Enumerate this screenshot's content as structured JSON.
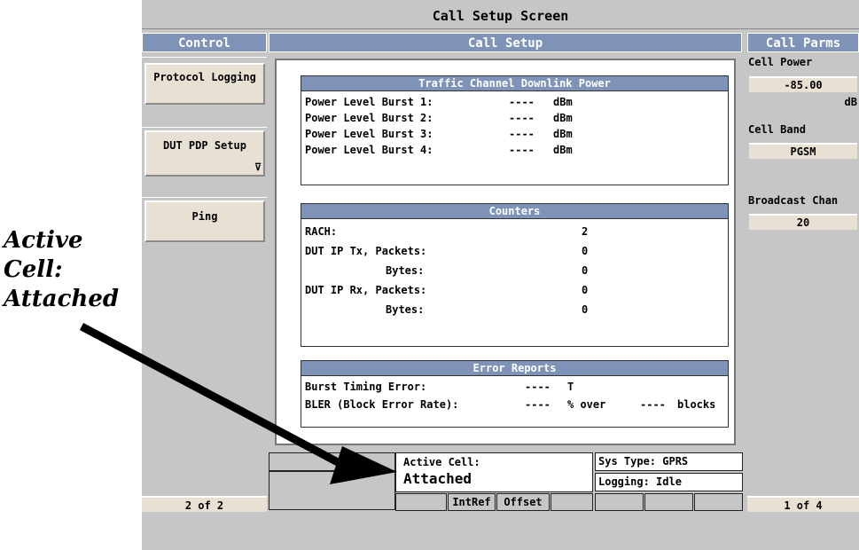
{
  "screen_title": "Call Setup Screen",
  "control": {
    "header": "Control",
    "keys": [
      {
        "label": "Protocol Logging"
      },
      {
        "label": "DUT PDP Setup",
        "arrow": "⊽"
      },
      {
        "label": "Ping"
      }
    ],
    "page": "2 of 2"
  },
  "call_setup": {
    "header": "Call Setup",
    "traffic": {
      "title": "Traffic Channel Downlink Power",
      "rows": [
        {
          "label": "Power Level Burst 1:",
          "value": "----",
          "unit": "dBm"
        },
        {
          "label": "Power Level Burst 2:",
          "value": "----",
          "unit": "dBm"
        },
        {
          "label": "Power Level Burst 3:",
          "value": "----",
          "unit": "dBm"
        },
        {
          "label": "Power Level Burst 4:",
          "value": "----",
          "unit": "dBm"
        }
      ]
    },
    "counters": {
      "title": "Counters",
      "rach_label": "RACH:",
      "rach_value": "2",
      "tx_label": "DUT IP Tx, Packets:",
      "tx_packets": "0",
      "tx_bytes_label": "Bytes:",
      "tx_bytes": "0",
      "rx_label": "DUT IP Rx, Packets:",
      "rx_packets": "0",
      "rx_bytes_label": "Bytes:",
      "rx_bytes": "0"
    },
    "errors": {
      "title": "Error Reports",
      "burst_label": "Burst Timing Error:",
      "burst_value": "----",
      "burst_unit": "T",
      "bler_label": "BLER (Block Error Rate):",
      "bler_value": "----",
      "bler_unit": "% over",
      "bler_blocks": "----",
      "bler_blocks_unit": "blocks"
    }
  },
  "call_parms": {
    "header": "Call Parms",
    "cell_power_label": "Cell Power",
    "cell_power_value": "-85.00",
    "cell_power_unit": "dB",
    "cell_band_label": "Cell Band",
    "cell_band_value": "PGSM",
    "bch_label": "Broadcast Chan",
    "bch_value": "20",
    "page": "1 of 4"
  },
  "status": {
    "active_cell_label": "Active Cell:",
    "active_cell_value": "Attached",
    "sys_type": "Sys Type: GPRS",
    "logging": "Logging: Idle",
    "intref": "IntRef",
    "offset": "Offset"
  },
  "annotation": {
    "line1": "Active",
    "line2": "Cell:",
    "line3": "Attached"
  }
}
